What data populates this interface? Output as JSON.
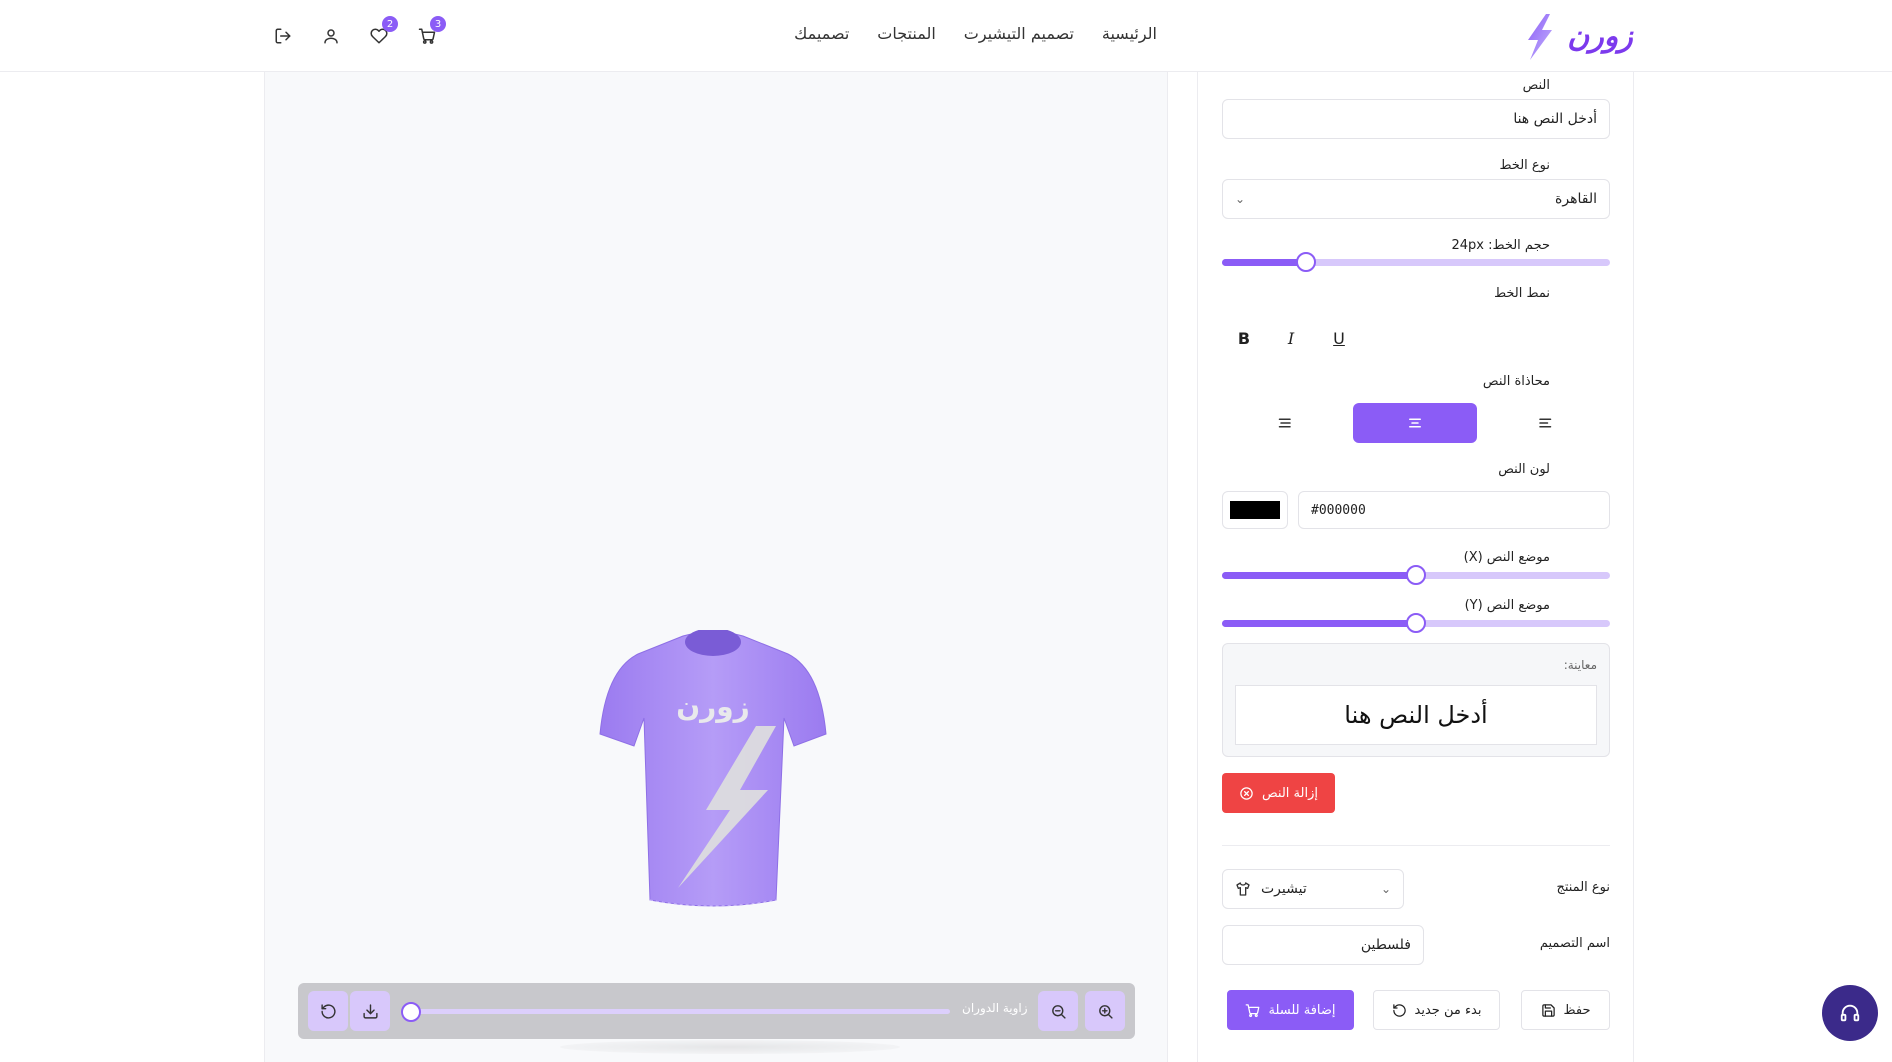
{
  "header": {
    "logo_text": "زورن",
    "nav": [
      "الرئيسية",
      "تصميم التيشيرت",
      "المنتجات",
      "تصميمك"
    ],
    "cart_count": "3",
    "wishlist_count": "2"
  },
  "canvas": {
    "shirt_print_text": "زورن",
    "rotation_label": "زاوية الدوران",
    "rotation_value": 0
  },
  "panel": {
    "text_label": "النص",
    "text_value": "أدخل النص هنا",
    "font_label": "نوع الخط",
    "font_value": "القاهرة",
    "size_label": "حجم الخط: 24px",
    "size_value": 24,
    "style_label": "نمط الخط",
    "style_buttons": [
      "B",
      "I",
      "U"
    ],
    "align_label": "محاذاة النص",
    "color_label": "لون النص",
    "color_value": "#000000",
    "pos_x_label": "موضع النص (X)",
    "pos_x_value": 50,
    "pos_y_label": "موضع النص (Y)",
    "pos_y_value": 50,
    "preview_label": "معاينة:",
    "preview_text": "أدخل النص هنا",
    "remove_label": "إزالة النص",
    "product_type_label": "نوع المنتج",
    "product_type_value": "تيشيرت",
    "design_name_label": "اسم التصميم",
    "design_name_value": "فلسطين",
    "save_label": "حفظ",
    "restart_label": "بدء من جديد",
    "add_to_cart_label": "إضافة للسلة"
  },
  "colors": {
    "accent": "#8b5cf6",
    "accent_light": "#d7c8fb",
    "danger": "#ef4444",
    "shirt": "#a78bfa",
    "support": "#3b2a8a"
  }
}
